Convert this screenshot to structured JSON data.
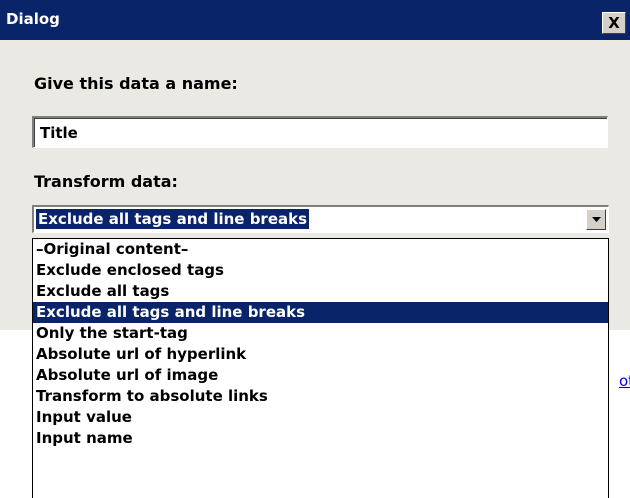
{
  "window": {
    "title": "Dialog",
    "close_label": "X"
  },
  "form": {
    "name_label": "Give this data a name:",
    "name_value": "Title",
    "transform_label": "Transform data:",
    "selected_option": "Exclude all tags and line breaks",
    "options": [
      "–Original content–",
      "Exclude enclosed tags",
      "Exclude all tags",
      "Exclude all tags and line breaks",
      "Only the start-tag",
      "Absolute url of hyperlink",
      "Absolute url of image",
      "Transform to absolute links",
      "Input value",
      "Input name"
    ]
  },
  "background": {
    "link_text": "ot"
  },
  "colors": {
    "titlebar": "#0a246a",
    "selection": "#0a246a",
    "dialog_bg": "#ebe9e4",
    "link": "#0000ee"
  },
  "icons": {
    "close": "close-icon",
    "dropdown": "chevron-down-icon"
  }
}
